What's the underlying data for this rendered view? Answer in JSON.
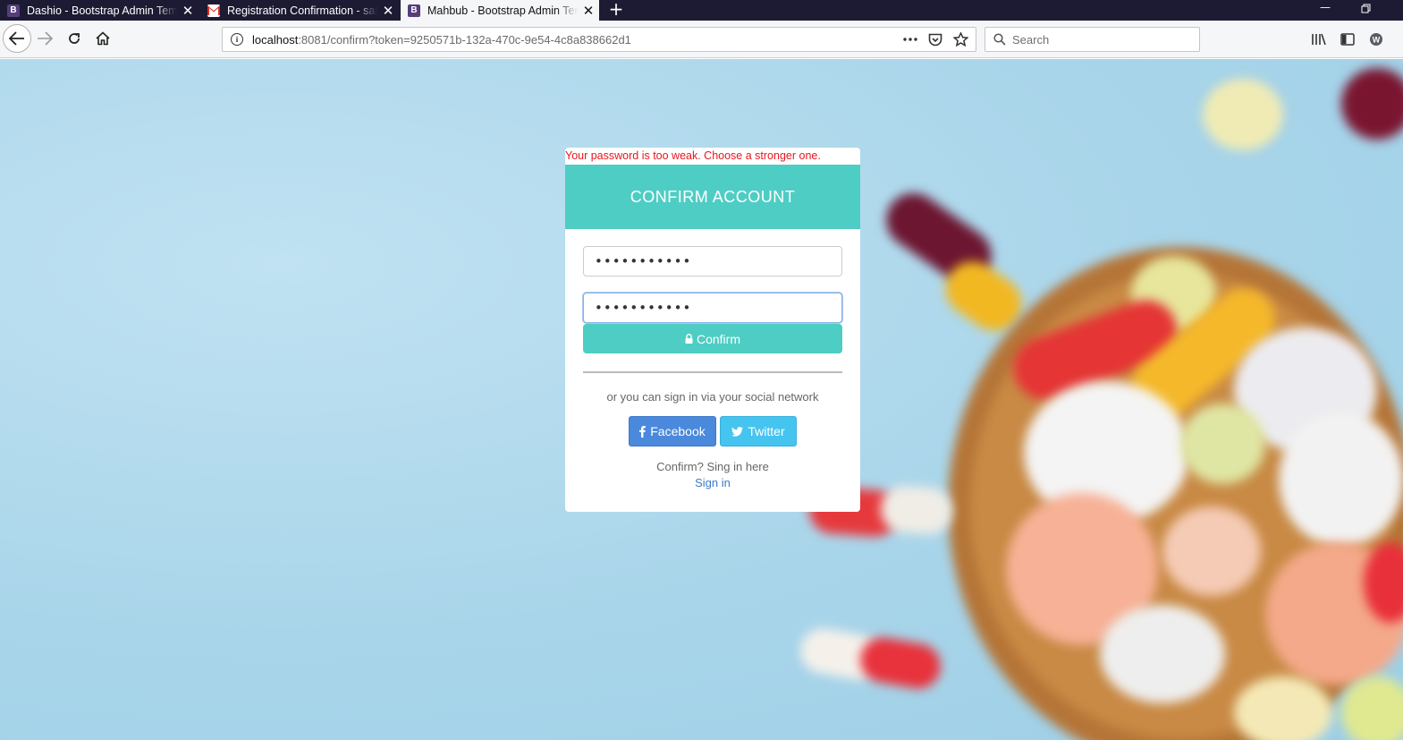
{
  "browser": {
    "tabs": [
      {
        "title": "Dashio - Bootstrap Admin Template",
        "favicon": "B",
        "active": false
      },
      {
        "title": "Registration Confirmation - sakib",
        "favicon": "M",
        "active": false
      },
      {
        "title": "Mahbub - Bootstrap Admin Template",
        "favicon": "B",
        "active": true
      }
    ],
    "url_host": "localhost",
    "url_rest": ":8081/confirm?token=9250571b-132a-470c-9e54-4c8a838662d1",
    "search_placeholder": "Search"
  },
  "form": {
    "warning": "Your password is too weak. Choose a stronger one.",
    "header": "CONFIRM ACCOUNT",
    "password_value": "•••••••••••",
    "confirm_value": "•••••••••••",
    "confirm_button": "Confirm",
    "social_text": "or you can sign in via your social network",
    "facebook_button": "Facebook",
    "twitter_button": "Twitter",
    "confirm_text": "Confirm? Sing in here",
    "signin_link": "Sign in"
  },
  "colors": {
    "accent": "#4ecdc4",
    "facebook": "#4a89dc",
    "twitter": "#46c4f0",
    "warning": "#e8171e"
  }
}
